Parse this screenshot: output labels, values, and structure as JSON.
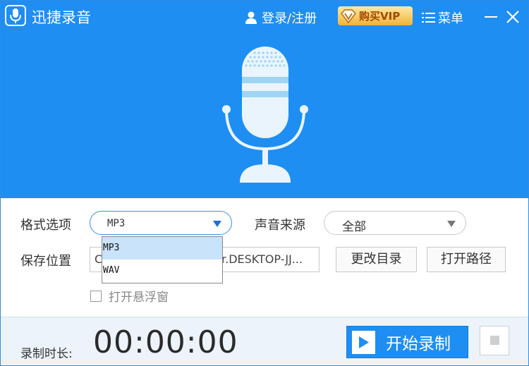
{
  "app": {
    "title": "迅捷录音"
  },
  "titlebar": {
    "login_label": "登录/注册",
    "vip_label": "购买VIP",
    "menu_label": "菜单"
  },
  "settings": {
    "format_label": "格式选项",
    "format_value": "MP3",
    "source_label": "声音来源",
    "source_value": "全部",
    "save_label": "保存位置",
    "save_path_prefix": "C",
    "save_path_visible": "r.DESKTOP-JJ...",
    "change_dir_label": "更改目录",
    "open_path_label": "打开路径",
    "floating_window_label": "打开悬浮窗",
    "floating_window_checked": false
  },
  "format_dropdown": {
    "options": [
      "MP3",
      "WAV"
    ],
    "selected": "MP3"
  },
  "footer": {
    "duration_label": "录制时长:",
    "timer": "00:00:00",
    "start_label": "开始录制"
  },
  "colors": {
    "brand_blue": "#1e8ef2",
    "vip_gold": "#f0b23a",
    "selected_option": "#c9e3fb"
  },
  "icons": [
    "app-mic-icon",
    "user-icon",
    "vip-diamond-icon",
    "menu-icon",
    "minimize-icon",
    "close-icon",
    "microphone-illustration",
    "chevron-down-icon",
    "play-icon",
    "stop-icon"
  ]
}
